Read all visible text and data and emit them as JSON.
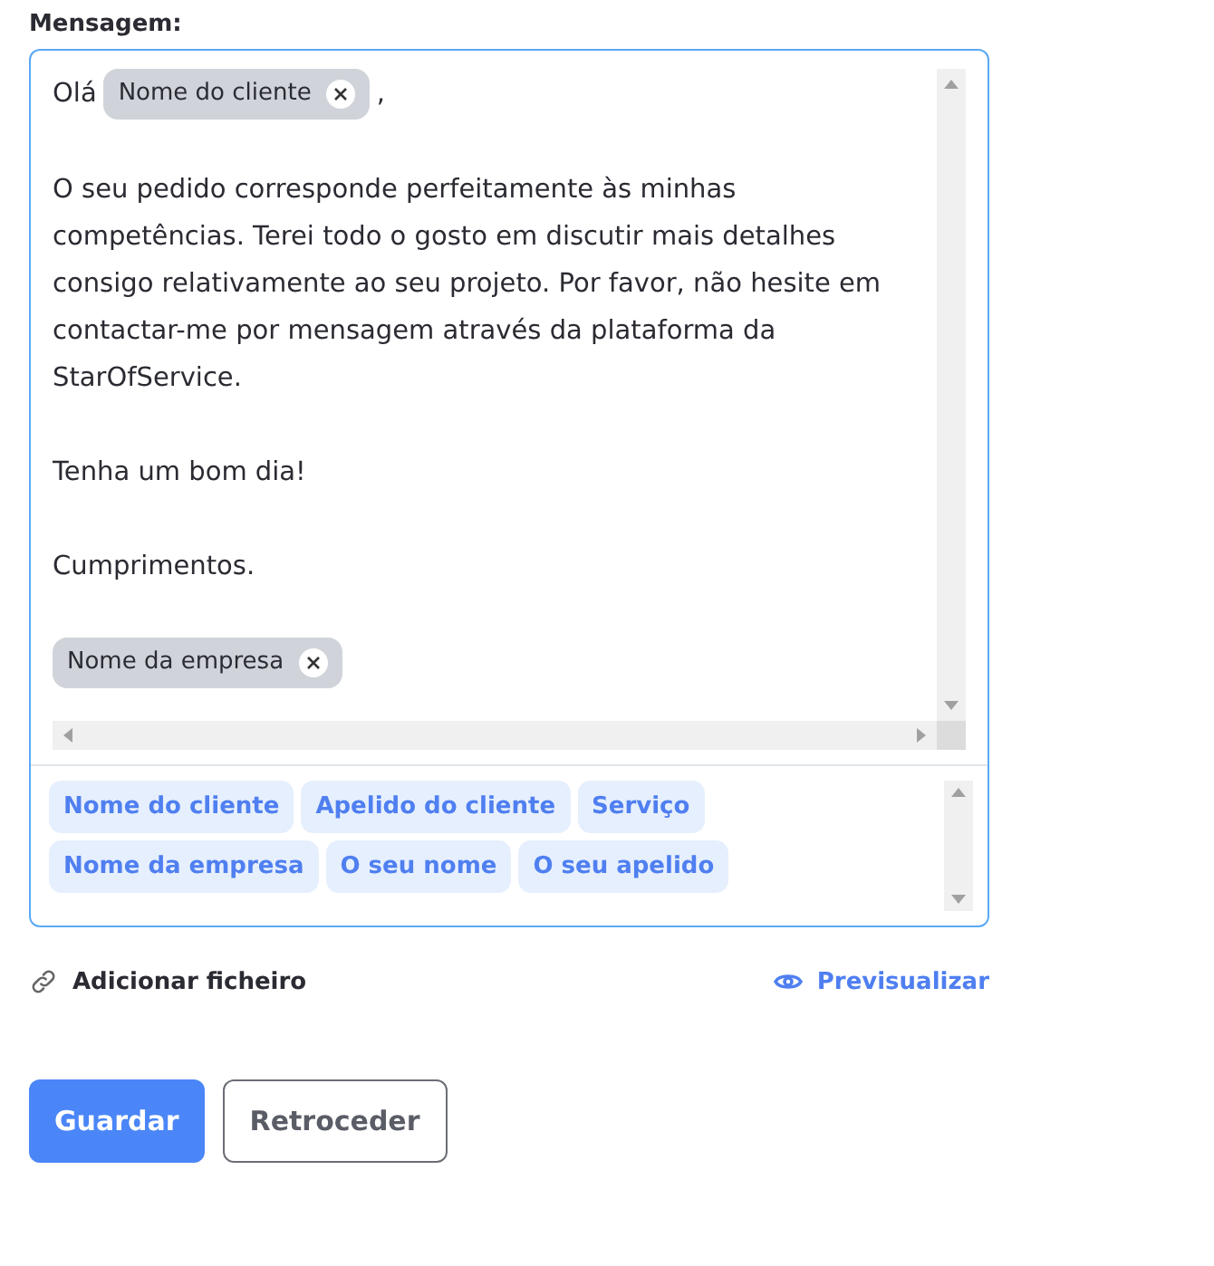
{
  "label": "Mensagem:",
  "message": {
    "greeting": {
      "before": "Olá",
      "chip": "Nome do cliente",
      "after": ","
    },
    "paragraphs": [
      "O seu pedido corresponde perfeitamente às minhas competências. Terei todo o gosto em discutir mais detalhes consigo relativamente ao seu projeto. Por favor, não hesite em contactar-me por mensagem através da plataforma da StarOfService.",
      "Tenha um bom dia!",
      "Cumprimentos."
    ],
    "signature_chip": "Nome da empresa"
  },
  "variables": [
    "Nome do cliente",
    "Apelido do cliente",
    "Serviço",
    "Nome da empresa",
    "O seu nome",
    "O seu apelido"
  ],
  "attach": "Adicionar ficheiro",
  "preview": "Previsualizar",
  "buttons": [
    {
      "label": "Guardar",
      "kind": "primary"
    },
    {
      "label": "Retroceder",
      "kind": "secondary"
    }
  ]
}
